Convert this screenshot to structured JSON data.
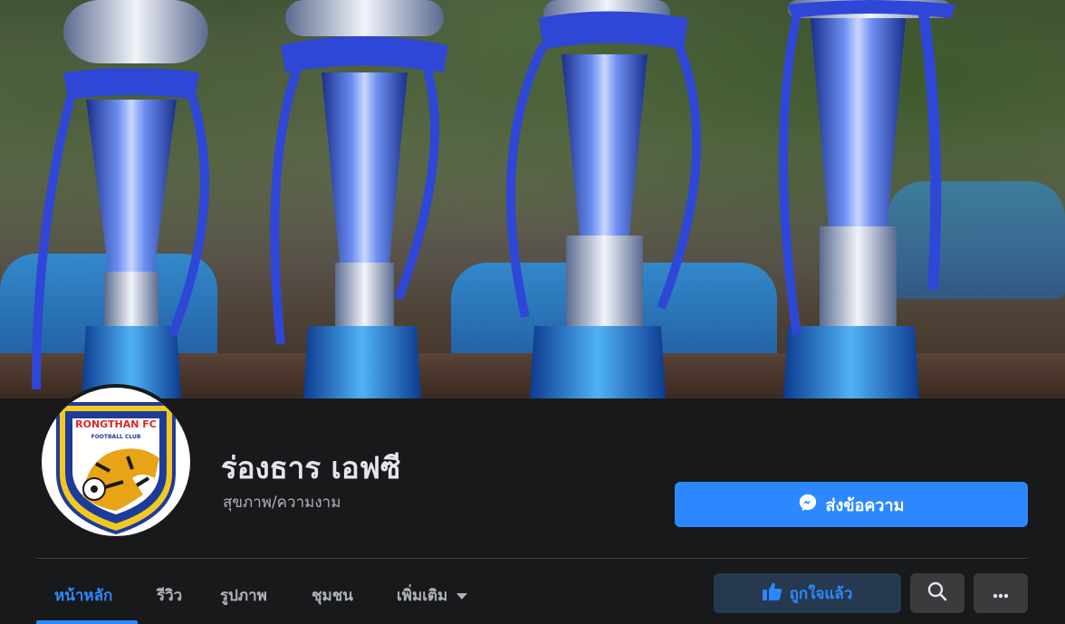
{
  "page": {
    "name": "ร่องธาร เอฟซี",
    "category": "สุขภาพ/ความงาม"
  },
  "logo": {
    "text_top": "RONGTHAN FC",
    "text_sub": "FOOTBALL CLUB"
  },
  "actions": {
    "message_label": "ส่งข้อความ",
    "liked_label": "ถูกใจแล้ว"
  },
  "tabs": [
    {
      "label": "หน้าหลัก",
      "active": true
    },
    {
      "label": "รีวิว",
      "active": false
    },
    {
      "label": "รูปภาพ",
      "active": false
    },
    {
      "label": "ชุมชน",
      "active": false
    },
    {
      "label": "เพิ่มเติม",
      "active": false
    }
  ],
  "icons": {
    "messenger": "messenger-icon",
    "like": "thumbs-up-icon",
    "search": "search-icon",
    "more": "more-icon",
    "dropdown": "caret-down-icon"
  },
  "colors": {
    "accent": "#2d88ff",
    "background": "#18191a",
    "button_secondary": "#3a3b3c",
    "liked_bg": "#263951"
  }
}
